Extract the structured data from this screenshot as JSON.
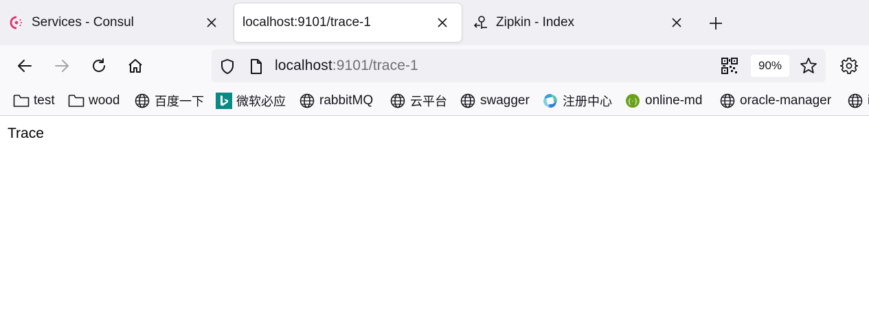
{
  "tabs": [
    {
      "title": "Services - Consul",
      "favicon": "consul-icon",
      "active": false
    },
    {
      "title": "localhost:9101/trace-1",
      "favicon": "",
      "active": true
    },
    {
      "title": "Zipkin - Index",
      "favicon": "zipkin-icon",
      "active": false
    }
  ],
  "urlbar": {
    "host": "localhost",
    "path": ":9101/trace-1",
    "zoom": "90%"
  },
  "bookmarks": [
    {
      "label": "test",
      "icon": "folder-icon"
    },
    {
      "label": "wood",
      "icon": "folder-icon"
    },
    {
      "label": "百度一下",
      "icon": "globe-icon"
    },
    {
      "label": "微软必应",
      "icon": "bing-icon"
    },
    {
      "label": "rabbitMQ",
      "icon": "globe-icon"
    },
    {
      "label": "云平台",
      "icon": "globe-icon"
    },
    {
      "label": "swagger",
      "icon": "globe-icon"
    },
    {
      "label": "注册中心",
      "icon": "nacos-icon"
    },
    {
      "label": "online-md",
      "icon": "online-md-icon"
    },
    {
      "label": "oracle-manager",
      "icon": "globe-icon"
    },
    {
      "label": "i",
      "icon": "globe-icon"
    }
  ],
  "page": {
    "text": "Trace"
  },
  "colors": {
    "tabstrip_bg": "#f0f0f4",
    "toolbar_bg": "#f9f9fb",
    "consul_pink": "#e03875",
    "bing_teal": "#0b8a85",
    "online_md_green": "#6aa11a"
  }
}
